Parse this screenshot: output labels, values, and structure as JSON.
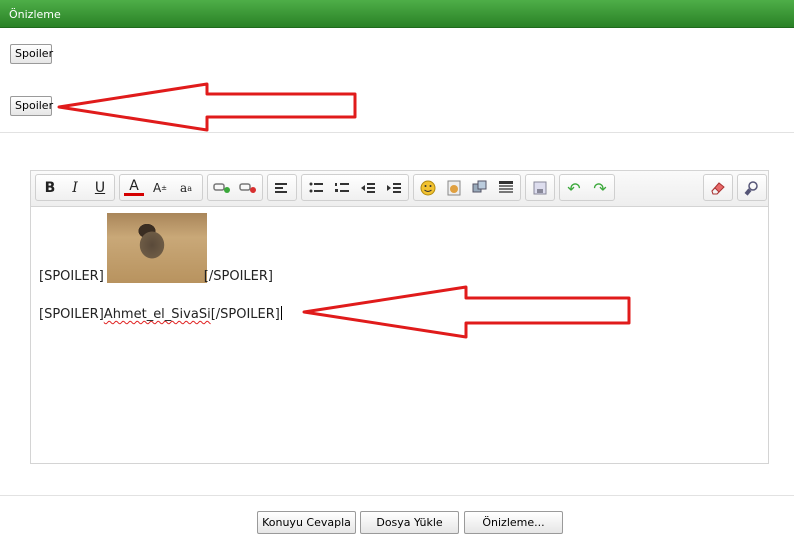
{
  "window": {
    "title": "Önizleme"
  },
  "preview": {
    "spoiler_button_1": "Spoiler",
    "spoiler_button_2": "Spoiler"
  },
  "editor": {
    "line1_prefix": "[SPOILER]",
    "line1_suffix": "[/SPOILER]",
    "line2_prefix": "[SPOILER]",
    "line2_word": "Ahmet_el_SivaSi",
    "line2_suffix": "[/SPOILER]"
  },
  "toolbar": {
    "icons": [
      "bold-icon",
      "italic-icon",
      "underline-icon",
      "text-color-icon",
      "superscript-icon",
      "font-size-icon",
      "insert-link-icon",
      "remove-link-icon",
      "align-icon",
      "bullet-list-icon",
      "numbered-list-icon",
      "outdent-icon",
      "indent-icon",
      "smiley-icon",
      "image-icon",
      "media-icon",
      "table-icon",
      "save-icon",
      "undo-icon",
      "redo-icon",
      "eraser-icon",
      "source-icon"
    ]
  },
  "footer": {
    "reply_button": "Konuyu Cevapla",
    "upload_button": "Dosya Yükle",
    "preview_button": "Önizleme..."
  },
  "colors": {
    "titlebar_green": "#3a9a34",
    "arrow_red": "#e01b1b"
  }
}
